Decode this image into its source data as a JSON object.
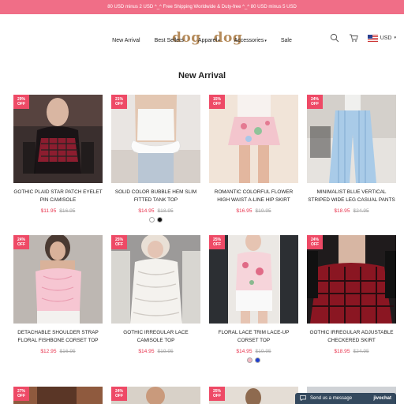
{
  "promo_bar": "80 USD minus 2 USD ^_^ Free Shipping Worldwide & Duty-free ^_^ 80 USD minus 5 USD",
  "logo": {
    "word1": "dog",
    "word2": "dog"
  },
  "header": {
    "currency": "USD",
    "icons": [
      "search-icon",
      "cart-icon",
      "us-flag-icon",
      "chevron-down-icon"
    ]
  },
  "nav": [
    {
      "label": "New Arrival",
      "dropdown": false
    },
    {
      "label": "Best Sellers",
      "dropdown": false
    },
    {
      "label": "Apparel",
      "dropdown": true
    },
    {
      "label": "Accessories",
      "dropdown": true
    },
    {
      "label": "Sale",
      "dropdown": false
    }
  ],
  "section_title": "New Arrival",
  "products": [
    {
      "badge_pct": "29%",
      "badge_off": "OFF",
      "title": "GOTHIC PLAID STAR PATCH EYELET PIN CAMISOLE",
      "price": "$11.95",
      "old_price": "$16.95"
    },
    {
      "badge_pct": "21%",
      "badge_off": "OFF",
      "title": "SOLID COLOR BUBBLE HEM SLIM FITTED TANK TOP",
      "price": "$14.95",
      "old_price": "$18.95",
      "swatches": [
        "#ffffff",
        "#111111"
      ]
    },
    {
      "badge_pct": "15%",
      "badge_off": "OFF",
      "title": "ROMANTIC COLORFUL FLOWER HIGH WAIST A-LINE HIP SKIRT",
      "price": "$16.95",
      "old_price": "$19.95"
    },
    {
      "badge_pct": "24%",
      "badge_off": "OFF",
      "title": "MINIMALIST BLUE VERTICAL STRIPED WIDE LEG CASUAL PANTS",
      "price": "$18.95",
      "old_price": "$24.95"
    },
    {
      "badge_pct": "24%",
      "badge_off": "OFF",
      "title": "DETACHABLE SHOULDER STRAP FLORAL FISHBONE CORSET TOP",
      "price": "$12.95",
      "old_price": "$16.95"
    },
    {
      "badge_pct": "25%",
      "badge_off": "OFF",
      "title": "GOTHIC IRREGULAR LACE CAMISOLE TOP",
      "price": "$14.95",
      "old_price": "$19.95"
    },
    {
      "badge_pct": "25%",
      "badge_off": "OFF",
      "title": "FLORAL LACE TRIM LACE-UP CORSET TOP",
      "price": "$14.95",
      "old_price": "$19.95",
      "swatches": [
        "#f4b8c4",
        "#1e3fd0"
      ]
    },
    {
      "badge_pct": "24%",
      "badge_off": "OFF",
      "title": "GOTHIC IRREGULAR ADJUSTABLE CHECKERED SKIRT",
      "price": "$18.95",
      "old_price": "$24.95"
    }
  ],
  "partial_row": [
    {
      "badge_pct": "27%",
      "badge_off": "OFF"
    },
    {
      "badge_pct": "24%",
      "badge_off": "OFF"
    },
    {
      "badge_pct": "25%",
      "badge_off": "OFF"
    },
    {
      "badge_pct": "",
      "badge_off": ""
    }
  ],
  "chat": {
    "label": "Send us a message",
    "brand": "jivochat"
  },
  "colors": {
    "promo_bg": "#f06e87",
    "badge_bg": "#ee4a66",
    "sale_price": "#e8354f",
    "logo": "#b58b5b",
    "chat_bg": "#34495e"
  }
}
